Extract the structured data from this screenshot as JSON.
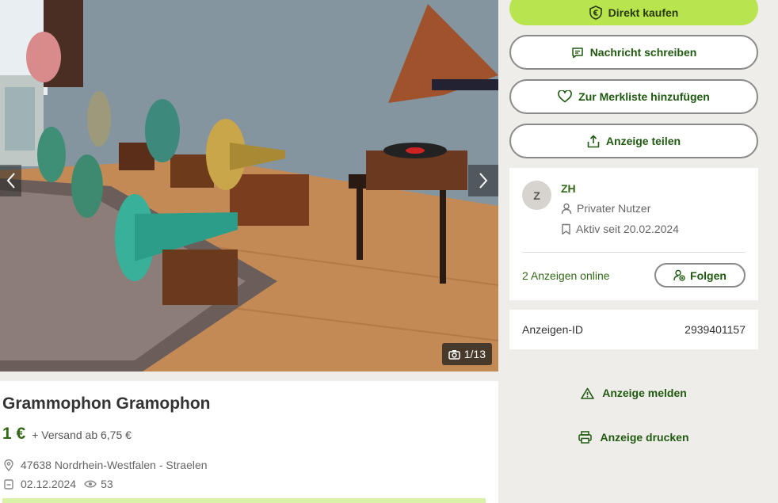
{
  "gallery": {
    "counter": "1/13",
    "prev_icon": "chevron-left-icon",
    "next_icon": "chevron-right-icon",
    "camera_icon": "camera-icon"
  },
  "ad": {
    "title": "Grammophon Gramophon",
    "price": "1 €",
    "shipping": "+ Versand ab 6,75 €",
    "location": "47638 Nordrhein-Westfalen - Straelen",
    "date": "02.12.2024",
    "views": "53"
  },
  "actions": {
    "buy_now": "Direkt kaufen",
    "message": "Nachricht schreiben",
    "watchlist": "Zur Merkliste hinzufügen",
    "share": "Anzeige teilen",
    "report": "Anzeige melden",
    "print": "Anzeige drucken"
  },
  "seller": {
    "avatar_letter": "Z",
    "name": "ZH",
    "type": "Privater Nutzer",
    "active_since": "Aktiv seit 20.02.2024",
    "ads_online": "2 Anzeigen online",
    "follow_label": "Folgen"
  },
  "ad_id": {
    "label": "Anzeigen-ID",
    "value": "2939401157"
  },
  "colors": {
    "brand_green": "#b8e44d",
    "text_green": "#326916",
    "background": "#efede9"
  }
}
